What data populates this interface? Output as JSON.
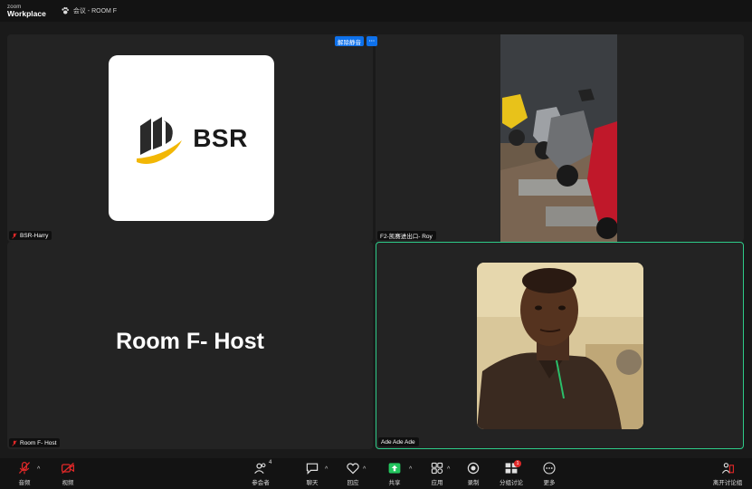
{
  "titlebar": {
    "logo_top": "zoom",
    "logo_bottom": "Workplace",
    "meeting_title": "会议 - ROOM F"
  },
  "stage": {
    "unmute_button": "解除静音",
    "more_button": "···",
    "tiles": [
      {
        "name": "BSR-Harry",
        "muted": true
      },
      {
        "name": "F2-凯赛进出口- Roy",
        "muted": false
      },
      {
        "name": "Room F- Host",
        "muted": true,
        "center_text": "Room F- Host"
      },
      {
        "name": "Ade Ade Ade",
        "muted": false,
        "active_speaker": true
      }
    ],
    "bsr_logo_text": "BSR"
  },
  "toolbar": {
    "audio": "音频",
    "video": "视频",
    "participants": "参会者",
    "participants_count": "4",
    "chat": "聊天",
    "reactions": "回应",
    "share": "共享",
    "apps": "应用",
    "record": "录制",
    "breakout": "分组讨论",
    "breakout_badge": "1",
    "more": "更多",
    "leave_breakout": "离开讨论组"
  },
  "colors": {
    "active_border": "#2ecb89",
    "accent_blue": "#0e71eb",
    "share_green": "#23c55e",
    "mute_red": "#e02828",
    "bsr_gold": "#f2b705"
  }
}
